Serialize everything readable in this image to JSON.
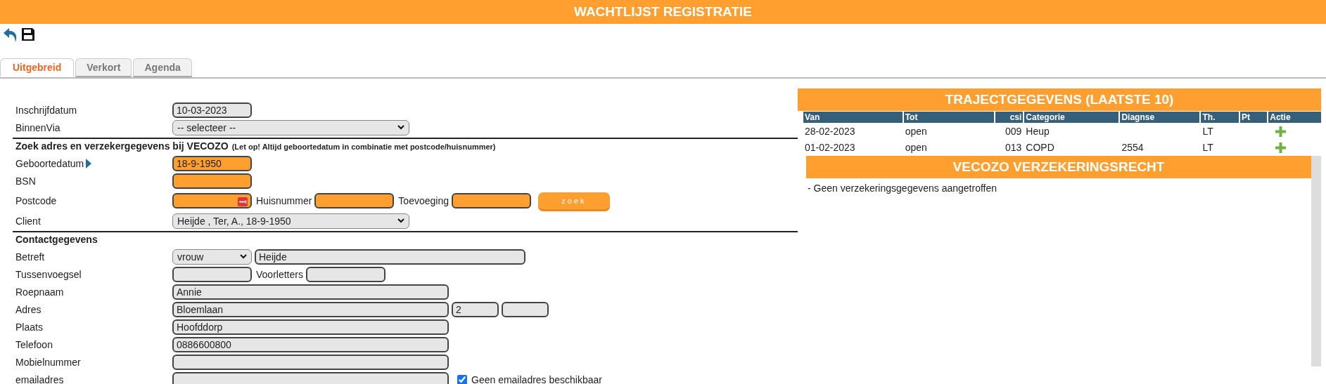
{
  "header": {
    "title": "WACHTLIJST REGISTRATIE"
  },
  "toolbar": [
    {
      "kind": "undo"
    },
    {
      "kind": "save"
    }
  ],
  "tabs": [
    {
      "label": "Uitgebreid",
      "selected": true
    },
    {
      "label": "Verkort",
      "selected": false
    },
    {
      "label": "Agenda",
      "selected": false
    }
  ],
  "form": {
    "rows": [
      {
        "kind": "field",
        "label": "Inschrijfdatum",
        "controls": [
          {
            "kind": "input",
            "value": "10-03-2023",
            "highlight": false
          }
        ]
      },
      {
        "kind": "field",
        "label": "BinnenVia",
        "controls": [
          {
            "kind": "select",
            "value": "-- selecteer --"
          }
        ]
      },
      {
        "kind": "divider"
      },
      {
        "kind": "heading",
        "text": "Zoek adres en verzekergegevens bij VECOZO",
        "note": "(Let op! Altijd geboortedatum in combinatie met postcode/huisnummer)"
      },
      {
        "kind": "field",
        "label": "Geboortedatum",
        "label_icon": true,
        "controls": [
          {
            "kind": "input",
            "value": "18-9-1950",
            "highlight": true
          }
        ]
      },
      {
        "kind": "field",
        "label": "BSN",
        "controls": [
          {
            "kind": "input",
            "highlight": true
          }
        ]
      },
      {
        "kind": "field",
        "label": "Postcode",
        "controls": [
          {
            "kind": "input",
            "highlight": true,
            "field_icon": true
          },
          {
            "kind": "text",
            "label": "Huisnummer"
          },
          {
            "kind": "input",
            "highlight": true
          },
          {
            "kind": "text",
            "label": "Toevoeging"
          },
          {
            "kind": "input",
            "highlight": true
          },
          {
            "kind": "button",
            "label": "zoek"
          }
        ]
      },
      {
        "kind": "field",
        "label": "Client",
        "controls": [
          {
            "kind": "select",
            "value": "Heijde , Ter, A., 18-9-1950"
          }
        ]
      },
      {
        "kind": "divider"
      },
      {
        "kind": "heading",
        "text": "Contactgegevens"
      },
      {
        "kind": "field",
        "label": "Betreft",
        "controls": [
          {
            "kind": "select",
            "value": "vrouw"
          },
          {
            "kind": "input",
            "value": "Heijde",
            "highlight": false
          }
        ]
      },
      {
        "kind": "field",
        "label": "Tussenvoegsel",
        "controls": [
          {
            "kind": "input",
            "highlight": false
          },
          {
            "kind": "text",
            "label": "Voorletters"
          },
          {
            "kind": "input",
            "highlight": false
          }
        ]
      },
      {
        "kind": "field",
        "label": "Roepnaam",
        "controls": [
          {
            "kind": "input",
            "value": "Annie",
            "highlight": false
          }
        ]
      },
      {
        "kind": "field",
        "label": "Adres",
        "controls": [
          {
            "kind": "input",
            "value": "Bloemlaan",
            "highlight": false
          },
          {
            "kind": "input",
            "value": "2",
            "highlight": false
          },
          {
            "kind": "input",
            "highlight": false
          }
        ]
      },
      {
        "kind": "field",
        "label": "Plaats",
        "controls": [
          {
            "kind": "input",
            "value": "Hoofddorp",
            "highlight": false
          }
        ]
      },
      {
        "kind": "field",
        "label": "Telefoon",
        "controls": [
          {
            "kind": "input",
            "value": "0886600800",
            "highlight": false
          }
        ]
      },
      {
        "kind": "field",
        "label": "Mobielnummer",
        "controls": [
          {
            "kind": "input",
            "highlight": false
          }
        ]
      },
      {
        "kind": "field",
        "label": "emailadres",
        "controls": [
          {
            "kind": "input",
            "highlight": false
          },
          {
            "kind": "checkbox",
            "label": "Geen emailadres beschikbaar",
            "checked": true
          }
        ]
      }
    ]
  },
  "traject": {
    "title": "TRAJECTGEGEVENS (LAATSTE 10)",
    "columns": [
      "Van",
      "Tot",
      "csi",
      "Categorie",
      "Diagnse",
      "Th.",
      "Pt",
      "Actie"
    ],
    "rows": [
      {
        "cells": [
          "28-02-2023",
          "open",
          "009",
          "Heup",
          null,
          "LT",
          null
        ]
      },
      {
        "cells": [
          "01-02-2023",
          "open",
          "013",
          "COPD",
          "2554",
          "LT",
          null
        ]
      }
    ]
  },
  "vecozo": {
    "title": "VECOZO VERZEKERINGSRECHT",
    "message": "- Geen verzekeringsgegevens aangetroffen"
  }
}
